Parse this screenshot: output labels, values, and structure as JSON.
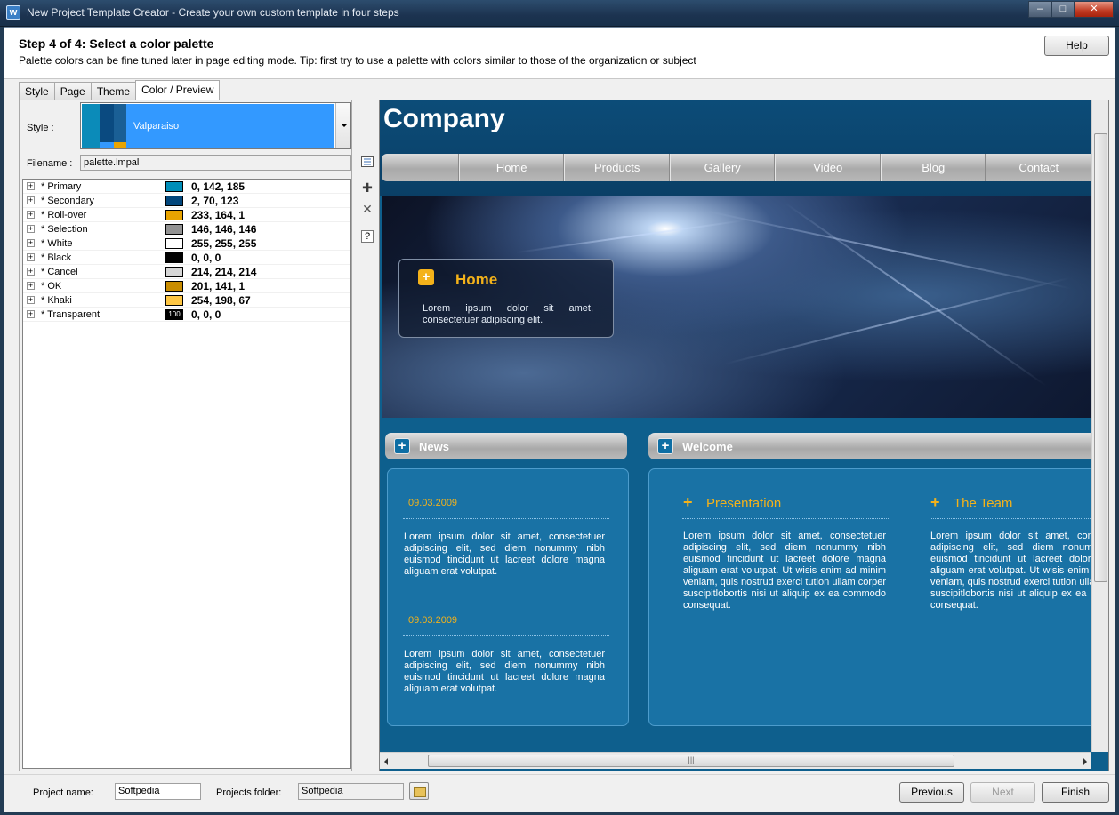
{
  "window": {
    "icon_glyph": "w",
    "title": "New Project Template Creator - Create your own custom template in four steps",
    "controls": [
      "–",
      "□",
      "✕"
    ]
  },
  "header": {
    "step_title": "Step 4 of 4: Select a color palette",
    "step_subtitle": "Palette colors can be fine tuned later in page editing mode. Tip: first try to use a palette with colors similar to those of the organization or subject",
    "help_label": "Help"
  },
  "tabs": [
    {
      "label": "Style"
    },
    {
      "label": "Page"
    },
    {
      "label": "Theme"
    },
    {
      "label": "Color / Preview"
    }
  ],
  "palette": {
    "style_label": "Style :",
    "style_value": "Valparaiso",
    "filename_label": "Filename :",
    "filename_value": "palette.lmpal",
    "colors": [
      {
        "name": "* Primary",
        "value": "0, 142, 185",
        "hex": "#008eb9"
      },
      {
        "name": "* Secondary",
        "value": "2, 70, 123",
        "hex": "#02467b"
      },
      {
        "name": "* Roll-over",
        "value": "233, 164, 1",
        "hex": "#e9a401"
      },
      {
        "name": "* Selection",
        "value": "146, 146, 146",
        "hex": "#929292"
      },
      {
        "name": "* White",
        "value": "255, 255, 255",
        "hex": "#ffffff"
      },
      {
        "name": "* Black",
        "value": "0, 0, 0",
        "hex": "#000000"
      },
      {
        "name": "* Cancel",
        "value": "214, 214, 214",
        "hex": "#d6d6d6"
      },
      {
        "name": "* OK",
        "value": "201, 141, 1",
        "hex": "#c98d01"
      },
      {
        "name": "* Khaki",
        "value": "254, 198, 67",
        "hex": "#fec643"
      },
      {
        "name": "* Transparent",
        "value": "0, 0, 0",
        "hex": "#000000",
        "badge": "100"
      }
    ],
    "expander_glyph": "+"
  },
  "tools": {
    "add_glyph": "✚",
    "delete_glyph": "✕",
    "help_glyph": "?"
  },
  "preview": {
    "company": "Company",
    "nav": [
      "Home",
      "Products",
      "Gallery",
      "Video",
      "Blog",
      "Contact"
    ],
    "hero_title": "Home",
    "hero_text": "Lorem ipsum dolor sit amet, consectetuer adipiscing elit.",
    "plus_glyph": "+",
    "news": {
      "title": "News",
      "items": [
        {
          "date": "09.03.2009",
          "text": "Lorem ipsum dolor sit amet, consectetuer adipiscing elit, sed diem nonummy nibh euismod tincidunt ut lacreet dolore magna aliguam erat volutpat."
        },
        {
          "date": "09.03.2009",
          "text": "Lorem ipsum dolor sit amet, consectetuer adipiscing elit, sed diem nonummy nibh euismod tincidunt ut lacreet dolore magna aliguam erat volutpat."
        }
      ]
    },
    "welcome": {
      "title": "Welcome",
      "presentation_title": "Presentation",
      "presentation_text": "Lorem ipsum dolor sit amet, consectetuer adipiscing elit, sed diem nonummy nibh euismod tincidunt ut lacreet dolore magna aliguam erat volutpat. Ut wisis enim ad minim veniam, quis nostrud exerci tution ullam corper suscipitlobortis nisi ut aliquip ex ea commodo consequat.",
      "team_title": "The Team",
      "team_text": "Lorem ipsum dolor sit amet, consectetuer adipiscing elit, sed diem nonummy nibh euismod tincidunt ut lacreet dolore magna aliguam erat volutpat. Ut wisis enim ad minim veniam, quis nostrud exerci tution ullam corper suscipitlobortis nisi ut aliquip ex ea commodo consequat."
    },
    "hscroll_grip": "|||"
  },
  "footer": {
    "project_name_label": "Project name:",
    "project_name_value": "Softpedia",
    "projects_folder_label": "Projects folder:",
    "projects_folder_value": "Softpedia",
    "previous_label": "Previous",
    "next_label": "Next",
    "finish_label": "Finish"
  }
}
